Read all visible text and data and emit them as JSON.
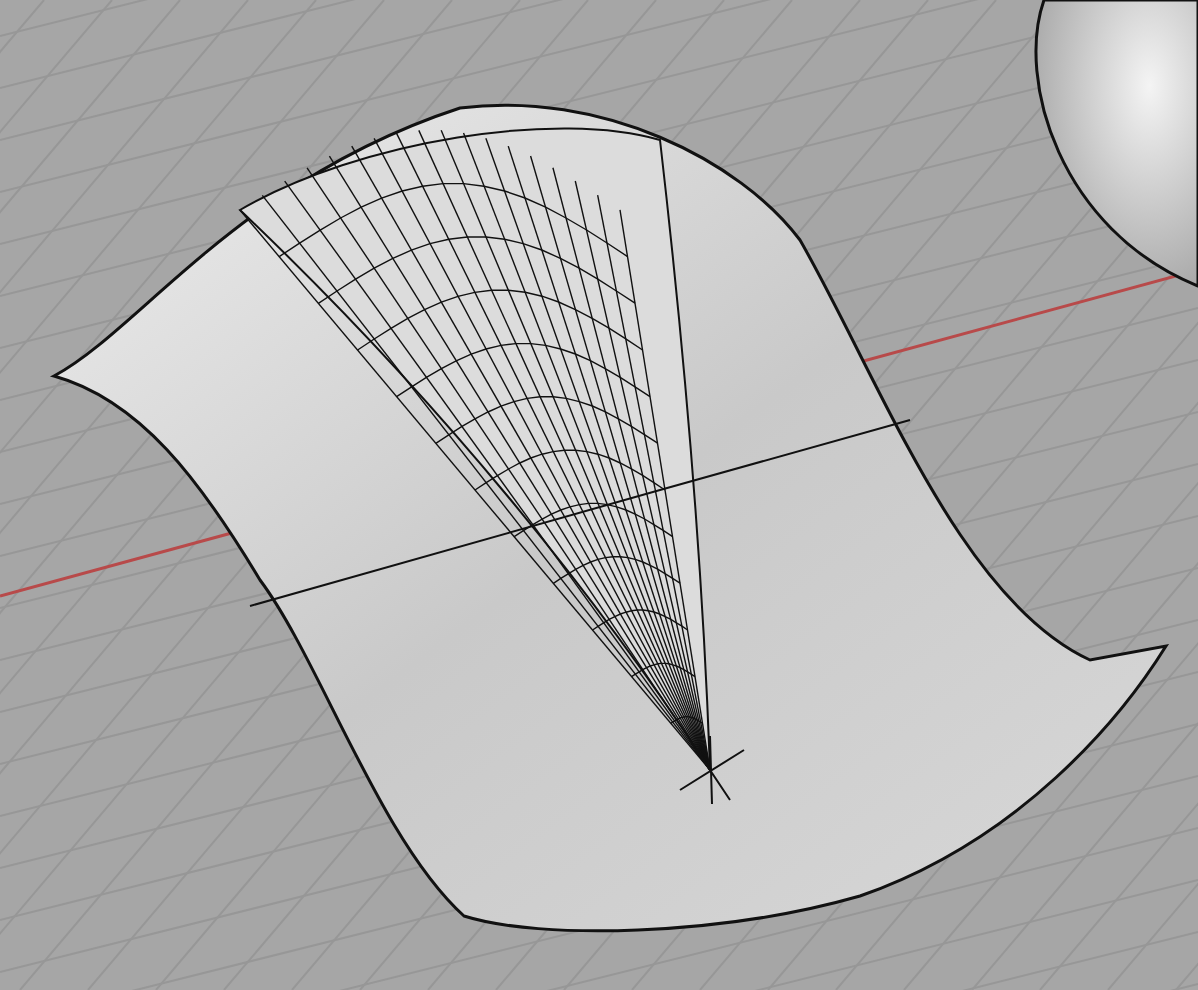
{
  "viewport": {
    "grid": true,
    "x_axis": true
  }
}
